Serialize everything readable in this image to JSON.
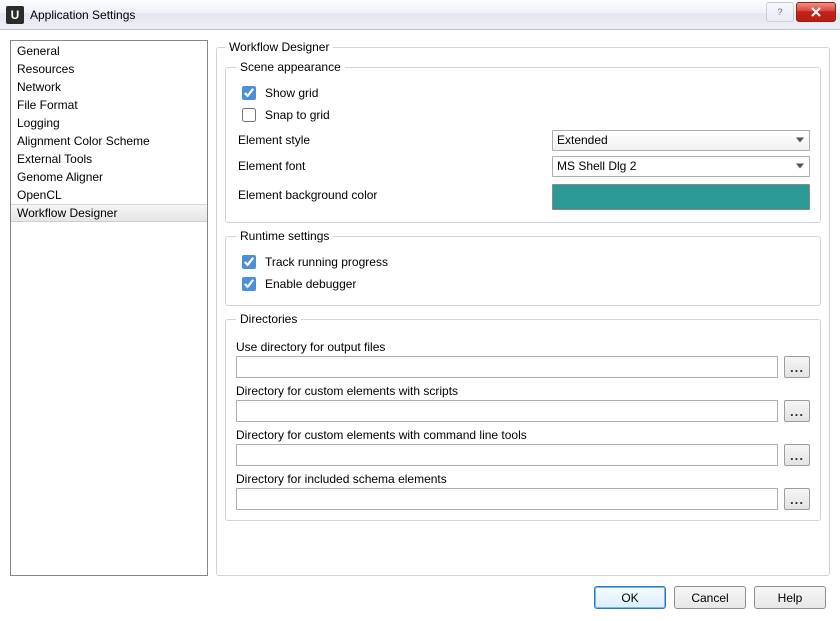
{
  "window": {
    "title": "Application Settings"
  },
  "categories": [
    "General",
    "Resources",
    "Network",
    "File Format",
    "Logging",
    "Alignment Color Scheme",
    "External Tools",
    "Genome Aligner",
    "OpenCL",
    "Workflow Designer"
  ],
  "selected_category_index": 9,
  "panel": {
    "title": "Workflow Designer",
    "scene": {
      "legend": "Scene appearance",
      "show_grid": {
        "label": "Show grid",
        "checked": true
      },
      "snap_to_grid": {
        "label": "Snap to grid",
        "checked": false
      },
      "element_style": {
        "label": "Element style",
        "value": "Extended",
        "options": [
          "Extended"
        ]
      },
      "element_font": {
        "label": "Element font",
        "value": "MS Shell Dlg 2"
      },
      "bg_color": {
        "label": "Element background color",
        "value": "#2b9a94"
      }
    },
    "runtime": {
      "legend": "Runtime settings",
      "track_progress": {
        "label": "Track running progress",
        "checked": true
      },
      "enable_debugger": {
        "label": "Enable debugger",
        "checked": true
      }
    },
    "dirs": {
      "legend": "Directories",
      "output": {
        "label": "Use directory for output files",
        "value": ""
      },
      "scripts": {
        "label": "Directory for custom elements with scripts",
        "value": ""
      },
      "cli": {
        "label": "Directory for custom elements with command line tools",
        "value": ""
      },
      "schema": {
        "label": "Directory for included schema elements",
        "value": ""
      }
    }
  },
  "buttons": {
    "ok": "OK",
    "cancel": "Cancel",
    "help": "Help",
    "browse": "..."
  }
}
